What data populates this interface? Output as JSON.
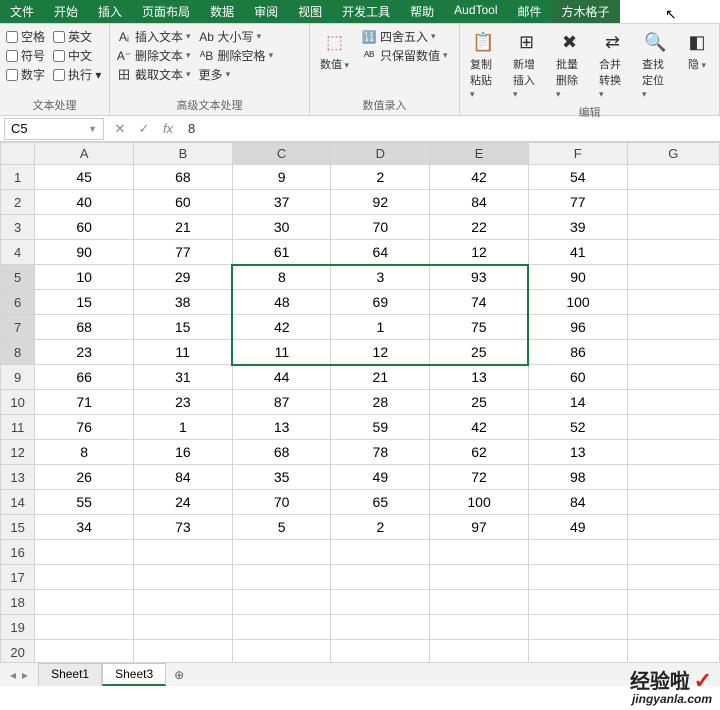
{
  "tabs": [
    "文件",
    "开始",
    "插入",
    "页面布局",
    "数据",
    "审阅",
    "视图",
    "开发工具",
    "帮助",
    "AudTool",
    "邮件",
    "方木格子"
  ],
  "active_tab_index": 11,
  "ribbon": {
    "g1": {
      "label": "文本处理",
      "checks": [
        "空格",
        "英文",
        "符号",
        "中文",
        "数字",
        "执行"
      ]
    },
    "g2": {
      "label": "高级文本处理",
      "items": [
        "插入文本",
        "大小写",
        "删除文本",
        "删除空格",
        "截取文本",
        "更多"
      ]
    },
    "g3": {
      "label": "数值录入",
      "big": "数值",
      "items": [
        "四舍五入",
        "只保留数值"
      ]
    },
    "g4": {
      "label": "编辑",
      "buttons": [
        "复制粘贴",
        "新增插入",
        "批量删除",
        "合并转换",
        "查找定位",
        "隐"
      ]
    }
  },
  "namebox": "C5",
  "formula": "8",
  "columns": [
    "A",
    "B",
    "C",
    "D",
    "E",
    "F",
    "G"
  ],
  "rows": [
    [
      45,
      68,
      9,
      2,
      42,
      54,
      ""
    ],
    [
      40,
      60,
      37,
      92,
      84,
      77,
      ""
    ],
    [
      60,
      21,
      30,
      70,
      22,
      39,
      ""
    ],
    [
      90,
      77,
      61,
      64,
      12,
      41,
      ""
    ],
    [
      10,
      29,
      8,
      3,
      93,
      90,
      ""
    ],
    [
      15,
      38,
      48,
      69,
      74,
      100,
      ""
    ],
    [
      68,
      15,
      42,
      1,
      75,
      96,
      ""
    ],
    [
      23,
      11,
      11,
      12,
      25,
      86,
      ""
    ],
    [
      66,
      31,
      44,
      21,
      13,
      60,
      ""
    ],
    [
      71,
      23,
      87,
      28,
      25,
      14,
      ""
    ],
    [
      76,
      1,
      13,
      59,
      42,
      52,
      ""
    ],
    [
      8,
      16,
      68,
      78,
      62,
      13,
      ""
    ],
    [
      26,
      84,
      35,
      49,
      72,
      98,
      ""
    ],
    [
      55,
      24,
      70,
      65,
      100,
      84,
      ""
    ],
    [
      34,
      73,
      5,
      2,
      97,
      49,
      ""
    ],
    [
      "",
      "",
      "",
      "",
      "",
      "",
      ""
    ],
    [
      "",
      "",
      "",
      "",
      "",
      "",
      ""
    ],
    [
      "",
      "",
      "",
      "",
      "",
      "",
      ""
    ],
    [
      "",
      "",
      "",
      "",
      "",
      "",
      ""
    ],
    [
      "",
      "",
      "",
      "",
      "",
      "",
      ""
    ]
  ],
  "selection": {
    "r1": 5,
    "r2": 8,
    "c1": 3,
    "c2": 5,
    "active_r": 5,
    "active_c": 3
  },
  "sheets": [
    "Sheet1",
    "Sheet3"
  ],
  "active_sheet": 1,
  "watermark": {
    "line1": "经验啦",
    "line2": "jingyanla.com"
  },
  "fx": {
    "cancel": "✕",
    "confirm": "✓",
    "fx": "fx"
  }
}
